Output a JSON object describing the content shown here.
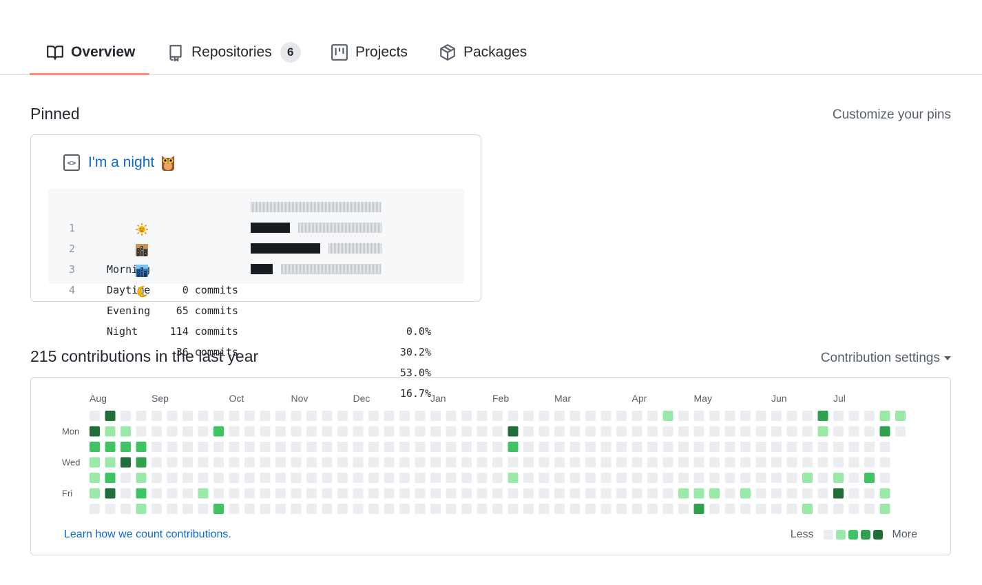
{
  "tabs": [
    {
      "id": "overview",
      "label": "Overview",
      "icon": "book-icon",
      "selected": true
    },
    {
      "id": "repositories",
      "label": "Repositories",
      "icon": "repo-icon",
      "count": "6"
    },
    {
      "id": "projects",
      "label": "Projects",
      "icon": "project-icon"
    },
    {
      "id": "packages",
      "label": "Packages",
      "icon": "package-icon"
    }
  ],
  "pinned": {
    "title": "Pinned",
    "customize_label": "Customize your pins",
    "gist": {
      "title": "I'm a night",
      "title_emoji": "owl-icon",
      "lines": [
        {
          "num": "1",
          "emoji": "sun-icon",
          "label": "Morning",
          "commits": "0 commits",
          "percent": "0.0%",
          "fraction": 0.0
        },
        {
          "num": "2",
          "emoji": "city-day-icon",
          "label": "Daytime",
          "commits": "65 commits",
          "percent": "30.2%",
          "fraction": 0.302
        },
        {
          "num": "3",
          "emoji": "city-dusk-icon",
          "label": "Evening",
          "commits": "114 commits",
          "percent": "53.0%",
          "fraction": 0.53
        },
        {
          "num": "4",
          "emoji": "crescent-moon-icon",
          "label": "Night",
          "commits": "36 commits",
          "percent": "16.7%",
          "fraction": 0.167
        }
      ]
    }
  },
  "contributions": {
    "title": "215 contributions in the last year",
    "settings_label": "Contribution settings",
    "learn_link": "Learn how we count contributions.",
    "legend_less": "Less",
    "legend_more": "More",
    "months": [
      {
        "label": "Aug",
        "week": 0
      },
      {
        "label": "Sep",
        "week": 4
      },
      {
        "label": "Oct",
        "week": 9
      },
      {
        "label": "Nov",
        "week": 13
      },
      {
        "label": "Dec",
        "week": 17
      },
      {
        "label": "Jan",
        "week": 22
      },
      {
        "label": "Feb",
        "week": 26
      },
      {
        "label": "Mar",
        "week": 30
      },
      {
        "label": "Apr",
        "week": 35
      },
      {
        "label": "May",
        "week": 39
      },
      {
        "label": "Jun",
        "week": 44
      },
      {
        "label": "Jul",
        "week": 48
      }
    ],
    "weekdays": [
      {
        "label": "Mon",
        "row": 1
      },
      {
        "label": "Wed",
        "row": 3
      },
      {
        "label": "Fri",
        "row": 5
      }
    ],
    "weeks": 53,
    "last_week_days": 2,
    "colors": [
      "#ebedf0",
      "#9be9a8",
      "#40c463",
      "#30a14e",
      "#216e39"
    ],
    "active_cells": [
      [
        0,
        1,
        4
      ],
      [
        0,
        2,
        2
      ],
      [
        0,
        3,
        1
      ],
      [
        0,
        4,
        1
      ],
      [
        0,
        5,
        1
      ],
      [
        1,
        0,
        4
      ],
      [
        1,
        1,
        1
      ],
      [
        1,
        2,
        2
      ],
      [
        1,
        3,
        1
      ],
      [
        1,
        4,
        2
      ],
      [
        1,
        5,
        4
      ],
      [
        2,
        1,
        1
      ],
      [
        2,
        2,
        2
      ],
      [
        2,
        3,
        4
      ],
      [
        3,
        2,
        2
      ],
      [
        3,
        3,
        3
      ],
      [
        3,
        4,
        1
      ],
      [
        3,
        5,
        2
      ],
      [
        3,
        6,
        1
      ],
      [
        7,
        5,
        1
      ],
      [
        8,
        1,
        2
      ],
      [
        8,
        6,
        2
      ],
      [
        27,
        1,
        4
      ],
      [
        27,
        2,
        2
      ],
      [
        27,
        4,
        1
      ],
      [
        37,
        0,
        1
      ],
      [
        38,
        5,
        1
      ],
      [
        39,
        5,
        1
      ],
      [
        39,
        6,
        3
      ],
      [
        40,
        5,
        1
      ],
      [
        42,
        5,
        1
      ],
      [
        46,
        4,
        1
      ],
      [
        46,
        6,
        1
      ],
      [
        47,
        0,
        3
      ],
      [
        47,
        1,
        1
      ],
      [
        48,
        4,
        1
      ],
      [
        48,
        5,
        4
      ],
      [
        50,
        4,
        2
      ],
      [
        51,
        0,
        1
      ],
      [
        51,
        1,
        3
      ],
      [
        51,
        5,
        1
      ],
      [
        51,
        6,
        1
      ],
      [
        52,
        0,
        1
      ],
      [
        52,
        5,
        1
      ]
    ]
  }
}
